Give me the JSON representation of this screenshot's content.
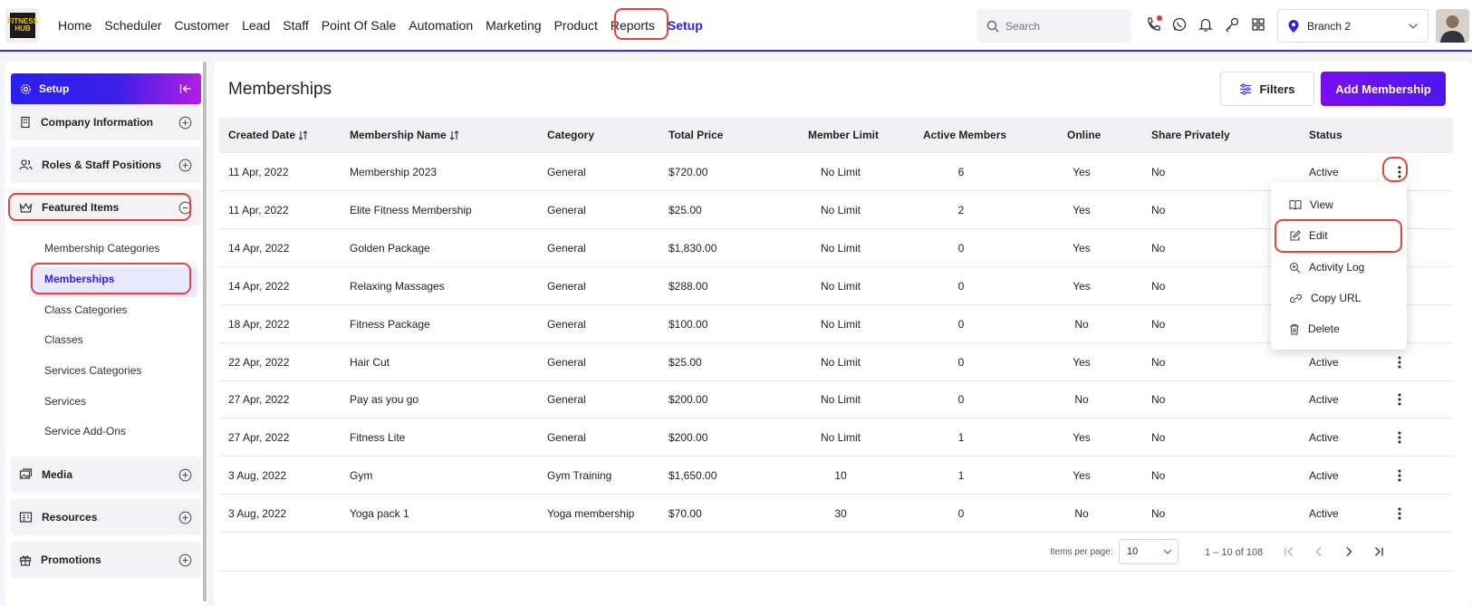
{
  "brand": {
    "logo_text": "FITNESS HUB"
  },
  "nav": {
    "items": [
      "Home",
      "Scheduler",
      "Customer",
      "Lead",
      "Staff",
      "Point Of Sale",
      "Automation",
      "Marketing",
      "Product",
      "Reports",
      "Setup"
    ],
    "active": "Setup"
  },
  "search": {
    "placeholder": "Search"
  },
  "branch": {
    "label": "Branch 2"
  },
  "sidebar": {
    "header": "Setup",
    "sections": [
      "Company Information",
      "Roles & Staff Positions",
      "Featured Items",
      "Media",
      "Resources",
      "Promotions"
    ],
    "featured_sub": [
      "Membership Categories",
      "Memberships",
      "Class Categories",
      "Classes",
      "Services Categories",
      "Services",
      "Service Add-Ons"
    ],
    "active_sub": "Memberships"
  },
  "page": {
    "title": "Memberships",
    "filters_label": "Filters",
    "add_label": "Add Membership"
  },
  "table": {
    "columns": [
      "Created Date",
      "Membership Name",
      "Category",
      "Total Price",
      "Member Limit",
      "Active Members",
      "Online",
      "Share Privately",
      "Status"
    ],
    "rows": [
      [
        "11 Apr, 2022",
        "Membership 2023",
        "General",
        "$720.00",
        "No Limit",
        "6",
        "Yes",
        "No",
        "Active"
      ],
      [
        "11 Apr, 2022",
        "Elite Fitness Membership",
        "General",
        "$25.00",
        "No Limit",
        "2",
        "Yes",
        "No",
        ""
      ],
      [
        "14 Apr, 2022",
        "Golden Package",
        "General",
        "$1,830.00",
        "No Limit",
        "0",
        "Yes",
        "No",
        ""
      ],
      [
        "14 Apr, 2022",
        "Relaxing Massages",
        "General",
        "$288.00",
        "No Limit",
        "0",
        "Yes",
        "No",
        ""
      ],
      [
        "18 Apr, 2022",
        "Fitness Package",
        "General",
        "$100.00",
        "No Limit",
        "0",
        "No",
        "No",
        ""
      ],
      [
        "22 Apr, 2022",
        "Hair Cut",
        "General",
        "$25.00",
        "No Limit",
        "0",
        "Yes",
        "No",
        "Active"
      ],
      [
        "27 Apr, 2022",
        "Pay as you go",
        "General",
        "$200.00",
        "No Limit",
        "0",
        "No",
        "No",
        "Active"
      ],
      [
        "27 Apr, 2022",
        "Fitness Lite",
        "General",
        "$200.00",
        "No Limit",
        "1",
        "Yes",
        "No",
        "Active"
      ],
      [
        "3 Aug, 2022",
        "Gym",
        "Gym Training",
        "$1,650.00",
        "10",
        "1",
        "Yes",
        "No",
        "Active"
      ],
      [
        "3 Aug, 2022",
        "Yoga pack 1",
        "Yoga membership",
        "$70.00",
        "30",
        "0",
        "No",
        "No",
        "Active"
      ]
    ]
  },
  "row_menu": {
    "items": [
      "View",
      "Edit",
      "Activity Log",
      "Copy URL",
      "Delete"
    ]
  },
  "pagination": {
    "items_per_page_label": "Items per page:",
    "page_size": "10",
    "range": "1 – 10 of 108"
  },
  "colors": {
    "accent": "#2d24e8",
    "highlight": "#e0463a"
  }
}
